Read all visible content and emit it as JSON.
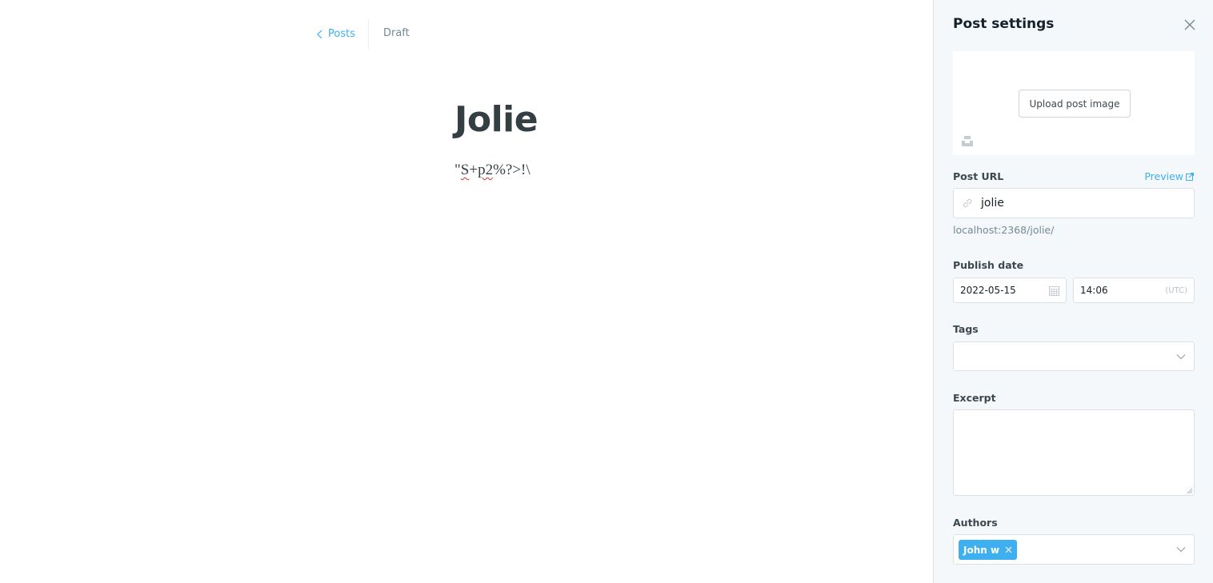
{
  "editor": {
    "back_label": "Posts",
    "status": "Draft",
    "title": "Jolie",
    "body_prefix": "\"",
    "body_squiggle1": "S",
    "body_plus": "+",
    "body_squiggle2": "p2",
    "body_suffix": "%?>!\\"
  },
  "settings": {
    "title": "Post settings",
    "upload_label": "Upload post image",
    "post_url_label": "Post URL",
    "preview_label": "Preview",
    "slug": "jolie",
    "url_help": "localhost:2368/jolie/",
    "publish_date_label": "Publish date",
    "date": "2022-05-15",
    "time": "14:06",
    "timezone": "(UTC)",
    "tags_label": "Tags",
    "excerpt_label": "Excerpt",
    "authors_label": "Authors",
    "author": "John w"
  },
  "colors": {
    "accent": "#3eb0ef",
    "panel_bg": "#f4f8fb"
  }
}
